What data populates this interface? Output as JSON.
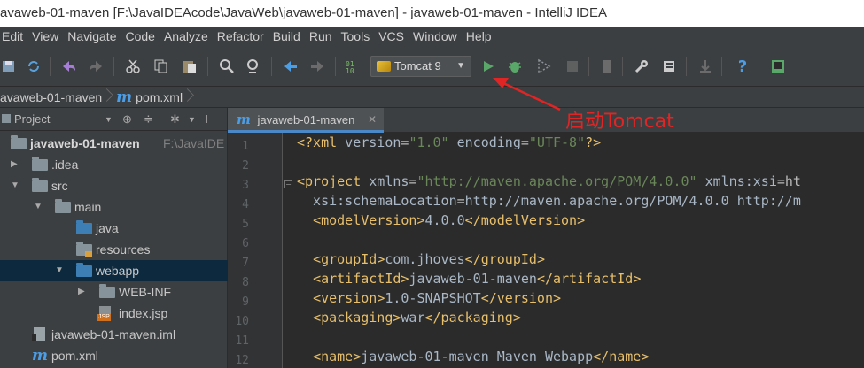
{
  "window": {
    "title": "avaweb-01-maven [F:\\JavaIDEAcode\\JavaWeb\\javaweb-01-maven] - javaweb-01-maven - IntelliJ IDEA"
  },
  "menu": {
    "items": [
      "Edit",
      "View",
      "Navigate",
      "Code",
      "Analyze",
      "Refactor",
      "Build",
      "Run",
      "Tools",
      "VCS",
      "Window",
      "Help"
    ]
  },
  "toolbar": {
    "run_config": "Tomcat 9",
    "icons": [
      "save-all-icon",
      "sync-icon",
      "undo-icon",
      "redo-icon",
      "cut-icon",
      "copy-icon",
      "paste-icon",
      "find-icon",
      "replace-icon",
      "back-icon",
      "forward-icon",
      "make-icon",
      "run-icon",
      "debug-icon",
      "coverage-icon",
      "stop-icon",
      "project-structure-icon",
      "settings-icon",
      "sdk-icon",
      "vcs-icon",
      "help-icon",
      "terminal-icon"
    ]
  },
  "breadcrumb": {
    "items": [
      "avaweb-01-maven",
      "pom.xml"
    ]
  },
  "project_panel": {
    "header": "Project",
    "tree": [
      {
        "label": "javaweb-01-maven",
        "hint": "F:\\JavaIDE",
        "type": "module",
        "expanded": true
      },
      {
        "label": ".idea",
        "type": "folder",
        "expanded": false
      },
      {
        "label": "src",
        "type": "folder",
        "expanded": true
      },
      {
        "label": "main",
        "type": "folder",
        "expanded": true
      },
      {
        "label": "java",
        "type": "source-folder"
      },
      {
        "label": "resources",
        "type": "resource-folder"
      },
      {
        "label": "webapp",
        "type": "web-folder",
        "expanded": true,
        "selected": true
      },
      {
        "label": "WEB-INF",
        "type": "folder",
        "expanded": false
      },
      {
        "label": "index.jsp",
        "type": "jsp-file"
      },
      {
        "label": "javaweb-01-maven.iml",
        "type": "iml-file"
      },
      {
        "label": "pom.xml",
        "type": "maven-file"
      }
    ]
  },
  "editor": {
    "tab_label": "javaweb-01-maven",
    "line_numbers": [
      "1",
      "2",
      "3",
      "4",
      "5",
      "6",
      "7",
      "8",
      "9",
      "10",
      "11",
      "12"
    ],
    "lines": [
      "<?xml version=\"1.0\" encoding=\"UTF-8\"?>",
      "",
      "<project xmlns=\"http://maven.apache.org/POM/4.0.0\" xmlns:xsi=\"ht",
      "  xsi:schemaLocation=\"http://maven.apache.org/POM/4.0.0 http://m",
      "  <modelVersion>4.0.0</modelVersion>",
      "",
      "  <groupId>com.jhoves</groupId>",
      "  <artifactId>javaweb-01-maven</artifactId>",
      "  <version>1.0-SNAPSHOT</version>",
      "  <packaging>war</packaging>",
      "",
      "  <name>javaweb-01-maven Maven Webapp</name>"
    ]
  },
  "annotation": {
    "text": "启动Tomcat",
    "color": "#e12424"
  }
}
